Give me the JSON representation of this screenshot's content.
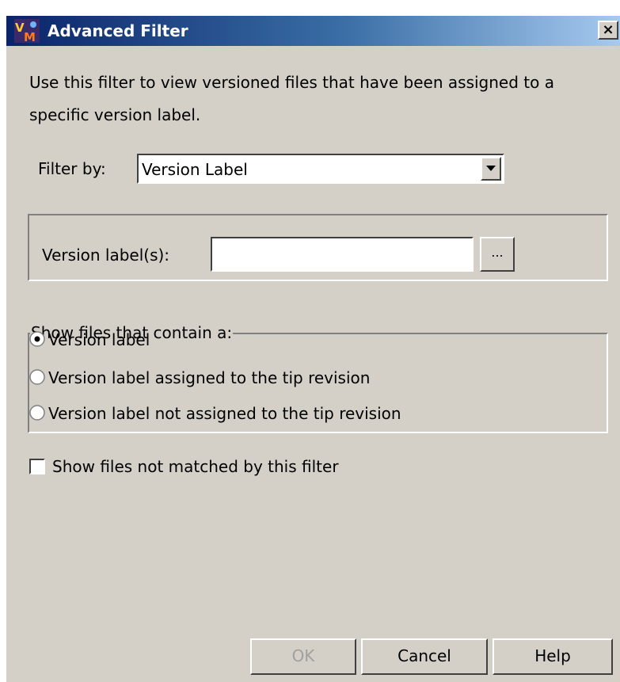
{
  "window": {
    "title": "Advanced Filter",
    "close_glyph": "×"
  },
  "description": {
    "line1": "Use this filter to view versioned files that have been assigned to a",
    "line2": "specific version label."
  },
  "filter": {
    "label": "Filter by:",
    "selected": "Version Label"
  },
  "version_labels": {
    "label": "Version label(s):",
    "value": "",
    "browse_label": "..."
  },
  "show_files": {
    "legend": "Show files that contain a:",
    "options": [
      {
        "label": "Version label",
        "checked": true
      },
      {
        "label": "Version label assigned to the tip revision",
        "checked": false
      },
      {
        "label": "Version label not assigned to the tip revision",
        "checked": false
      }
    ]
  },
  "not_matched": {
    "label": "Show files not matched by this filter",
    "checked": false
  },
  "buttons": {
    "ok": "OK",
    "cancel": "Cancel",
    "help": "Help"
  },
  "icons": {
    "app": "vm-app-icon",
    "combo_arrow": "triangle-down-icon"
  },
  "colors": {
    "titlebar_start": "#0a246a",
    "titlebar_end": "#a6caf0",
    "dialog_bg": "#d4d0c8"
  }
}
